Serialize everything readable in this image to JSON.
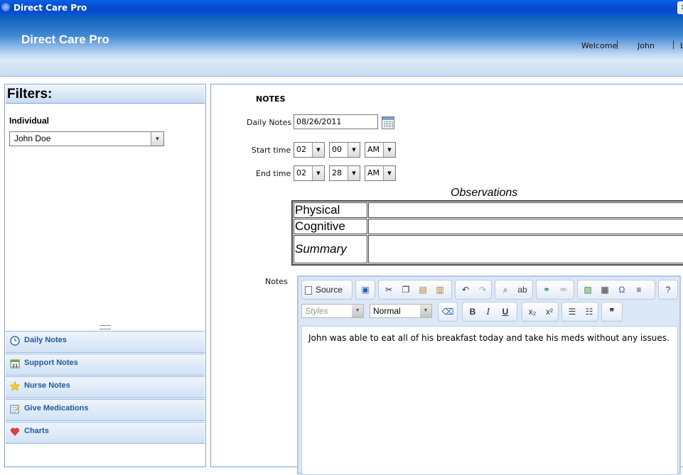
{
  "window": {
    "title": "Direct Care Pro"
  },
  "header": {
    "app_name": "Direct Care Pro",
    "welcome": "Welcome",
    "user": "John",
    "extra": "L"
  },
  "filters": {
    "title": "Filters:",
    "individual_label": "Individual",
    "individual_value": "John Doe"
  },
  "nav": {
    "items": [
      {
        "label": "Daily Notes",
        "icon": "clock-icon"
      },
      {
        "label": "Support Notes",
        "icon": "calendar-icon"
      },
      {
        "label": "Nurse Notes",
        "icon": "star-icon"
      },
      {
        "label": "Give Medications",
        "icon": "notepad-icon"
      },
      {
        "label": "Charts",
        "icon": "heart-icon"
      }
    ]
  },
  "notes": {
    "title": "NOTES",
    "daily_notes_label": "Daily Notes",
    "daily_notes_value": "08/26/2011",
    "start_time_label": "Start time",
    "start_hour": "02",
    "start_minute": "00",
    "start_ampm": "AM",
    "end_time_label": "End time",
    "end_hour": "02",
    "end_minute": "28",
    "end_ampm": "AM",
    "observations_title": "Observations",
    "observations": [
      {
        "label": "Physical",
        "value": ""
      },
      {
        "label": "Cognitive",
        "value": ""
      },
      {
        "label": "Summary",
        "value": ""
      }
    ],
    "notes_label": "Notes"
  },
  "editor": {
    "source_label": "Source",
    "styles_placeholder": "Styles",
    "format_value": "Normal",
    "content": "John was able to eat all of his breakfast today and take his meds without any issues."
  }
}
